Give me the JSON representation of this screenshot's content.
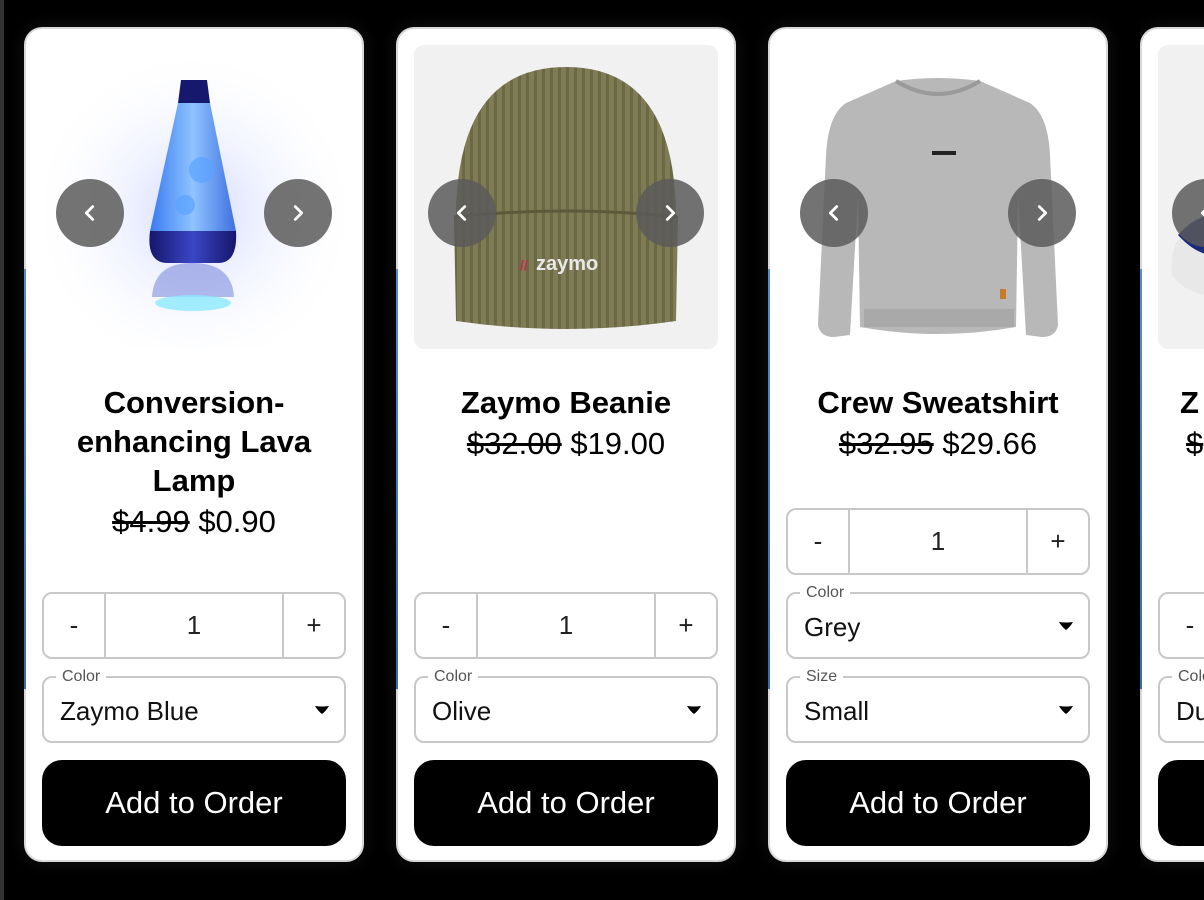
{
  "products": [
    {
      "title": "Conversion-enhancing Lava Lamp",
      "old_price": "$4.99",
      "price": "$0.90",
      "quantity": "1",
      "selects": [
        {
          "label": "Color",
          "value": "Zaymo Blue"
        }
      ],
      "add_label": "Add to Order"
    },
    {
      "title": "Zaymo Beanie",
      "old_price": "$32.00",
      "price": "$19.00",
      "quantity": "1",
      "selects": [
        {
          "label": "Color",
          "value": "Olive"
        }
      ],
      "add_label": "Add to Order",
      "logo_text": "zaymo"
    },
    {
      "title": "Crew Sweatshirt",
      "old_price": "$32.95",
      "price": "$29.66",
      "quantity": "1",
      "selects": [
        {
          "label": "Color",
          "value": "Grey"
        },
        {
          "label": "Size",
          "value": "Small"
        }
      ],
      "add_label": "Add to Order"
    },
    {
      "title": "Z",
      "old_price": "$",
      "quantity": "-",
      "selects": [
        {
          "label": "Colo",
          "value": "Du"
        }
      ]
    }
  ],
  "controls": {
    "minus": "-",
    "plus": "+"
  },
  "icons": {
    "prev": "chevron-left-icon",
    "next": "chevron-right-icon",
    "caret": "caret-down-icon"
  }
}
